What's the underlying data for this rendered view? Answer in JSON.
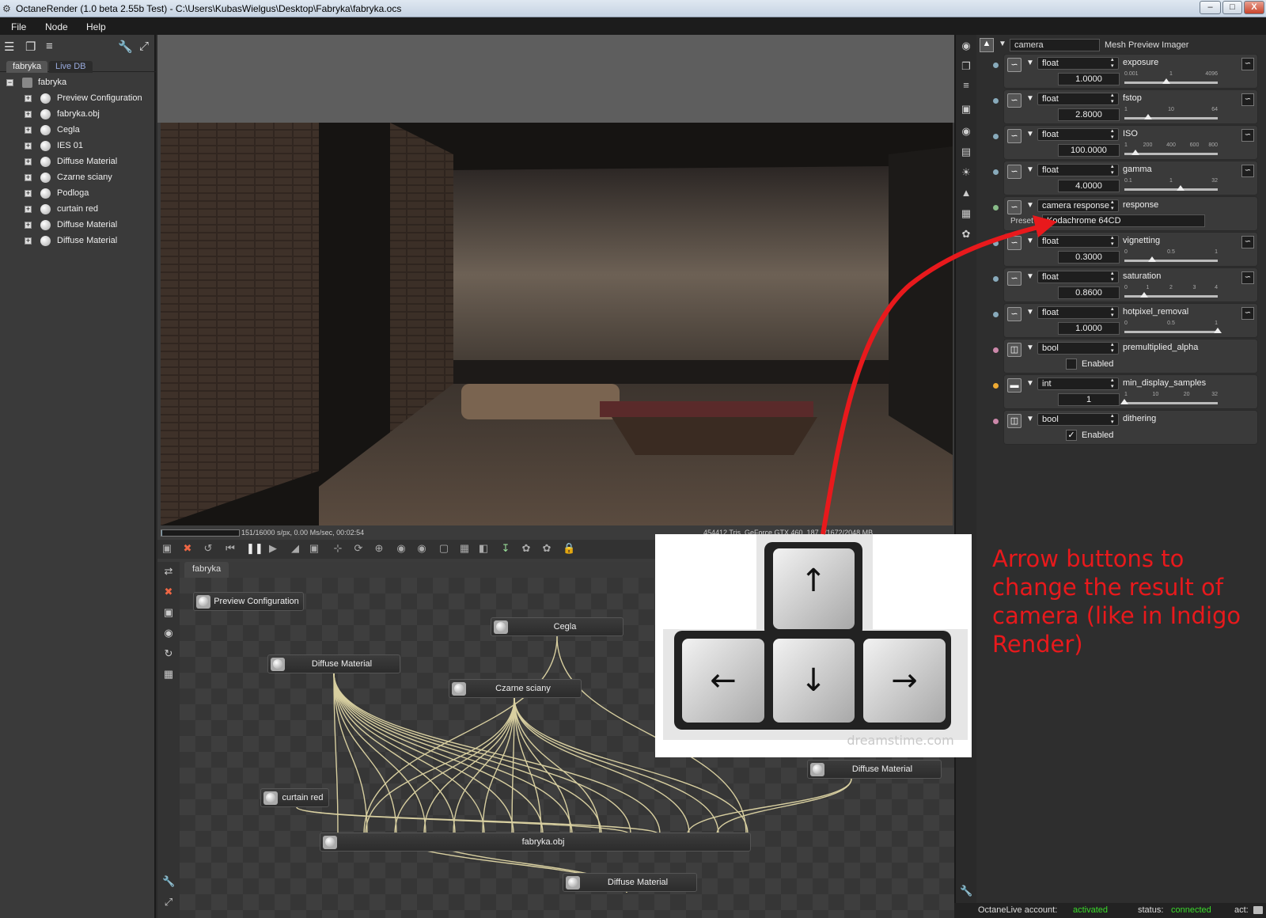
{
  "window": {
    "title": "OctaneRender (1.0 beta 2.55b Test) - C:\\Users\\KubasWielgus\\Desktop\\Fabryka\\fabryka.ocs",
    "minimize": "–",
    "maximize": "□",
    "close": "X"
  },
  "menu": {
    "file": "File",
    "node": "Node",
    "help": "Help"
  },
  "scene_tree": {
    "tabs": [
      "fabryka",
      "Live DB"
    ],
    "root": "fabryka",
    "items": [
      "Preview Configuration",
      "fabryka.obj",
      "Cegla",
      "IES 01",
      "Diffuse Material",
      "Czarne sciany",
      "Podloga",
      "curtain red",
      "Diffuse Material",
      "Diffuse Material"
    ]
  },
  "render": {
    "stats": "151/16000 s/px, 0.00 Ms/sec, 00:02:54",
    "gpu": "454412 Tris, GeForce GTX 460, 187.8/1672/2048 MB",
    "progress": 0.01
  },
  "node_editor": {
    "tab": "fabryka",
    "nodes": {
      "preview": "Preview Configuration",
      "cegla": "Cegla",
      "diffuse1": "Diffuse Material",
      "czarne": "Czarne sciany",
      "curtain": "curtain red",
      "diffuse2": "Diffuse Material",
      "fabryka_obj": "fabryka.obj",
      "diffuse3": "Diffuse Material"
    }
  },
  "inspector": {
    "node_type": "camera",
    "node_title": "Mesh Preview Imager",
    "params": [
      {
        "type": "float",
        "name": "exposure",
        "value": "1.0000",
        "ticks": [
          "0.001",
          "1",
          "4096"
        ],
        "pos": 0.45
      },
      {
        "type": "float",
        "name": "fstop",
        "value": "2.8000",
        "ticks": [
          "1",
          "10",
          "64"
        ],
        "pos": 0.25
      },
      {
        "type": "float",
        "name": "ISO",
        "value": "100.0000",
        "ticks": [
          "1",
          "200",
          "400",
          "600",
          "800"
        ],
        "pos": 0.12
      },
      {
        "type": "float",
        "name": "gamma",
        "value": "4.0000",
        "ticks": [
          "0.1",
          "1",
          "32"
        ],
        "pos": 0.6
      },
      {
        "type": "camera response",
        "name": "response",
        "preset_label": "Preset",
        "preset": "Kodachrome 64CD"
      },
      {
        "type": "float",
        "name": "vignetting",
        "value": "0.3000",
        "ticks": [
          "0",
          "0.5",
          "1"
        ],
        "pos": 0.3
      },
      {
        "type": "float",
        "name": "saturation",
        "value": "0.8600",
        "ticks": [
          "0",
          "1",
          "2",
          "3",
          "4"
        ],
        "pos": 0.21
      },
      {
        "type": "float",
        "name": "hotpixel_removal",
        "value": "1.0000",
        "ticks": [
          "0",
          "0.5",
          "1"
        ],
        "pos": 1.0
      },
      {
        "type": "bool",
        "name": "premultiplied_alpha",
        "check": "",
        "label": "Enabled"
      },
      {
        "type": "int",
        "name": "min_display_samples",
        "value": "1",
        "ticks": [
          "1",
          "10",
          "20",
          "32"
        ],
        "pos": 0.0
      },
      {
        "type": "bool",
        "name": "dithering",
        "check": "✓",
        "label": "Enabled"
      }
    ]
  },
  "status": {
    "account_label": "OctaneLive account:",
    "account_value": "activated",
    "status_label": "status:",
    "status_value": "connected",
    "act_label": "act:"
  },
  "overlay": {
    "watermark": "dreamstime.com",
    "arrows": {
      "up": "↑",
      "left": "←",
      "down": "↓",
      "right": "→"
    }
  },
  "annotation": {
    "text": "Arrow buttons to change the result of camera (like in Indigo Render)"
  },
  "colors": {
    "annotation": "#e8191c",
    "active_green": "#3adc2a"
  }
}
